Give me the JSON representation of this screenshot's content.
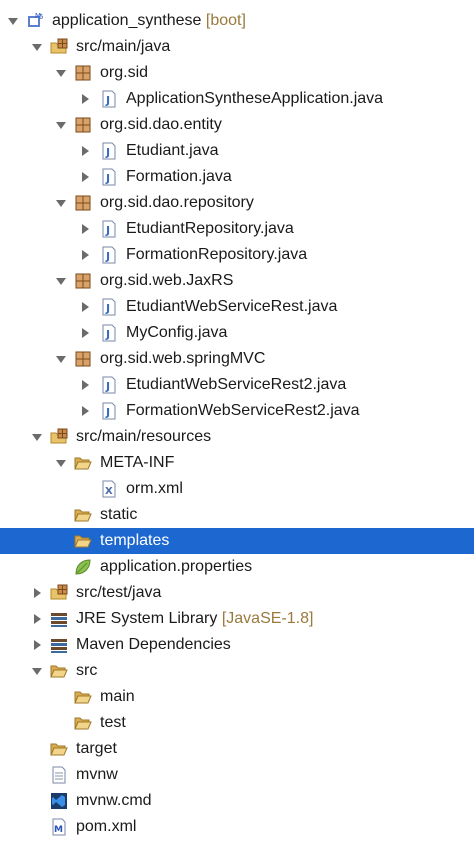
{
  "tree": {
    "project": {
      "label": "application_synthese",
      "decoration": "[boot]"
    },
    "src_main_java": {
      "label": "src/main/java"
    },
    "pkg_org_sid": {
      "label": "org.sid"
    },
    "file_app": {
      "label": "ApplicationSyntheseApplication.java"
    },
    "pkg_dao_entity": {
      "label": "org.sid.dao.entity"
    },
    "file_etudiant": {
      "label": "Etudiant.java"
    },
    "file_formation": {
      "label": "Formation.java"
    },
    "pkg_dao_repository": {
      "label": "org.sid.dao.repository"
    },
    "file_etu_repo": {
      "label": "EtudiantRepository.java"
    },
    "file_form_repo": {
      "label": "FormationRepository.java"
    },
    "pkg_web_jaxrs": {
      "label": "org.sid.web.JaxRS"
    },
    "file_etu_ws": {
      "label": "EtudiantWebServiceRest.java"
    },
    "file_myconfig": {
      "label": "MyConfig.java"
    },
    "pkg_web_springmvc": {
      "label": "org.sid.web.springMVC"
    },
    "file_etu_ws2": {
      "label": "EtudiantWebServiceRest2.java"
    },
    "file_form_ws2": {
      "label": "FormationWebServiceRest2.java"
    },
    "src_main_resources": {
      "label": "src/main/resources"
    },
    "folder_meta_inf": {
      "label": "META-INF"
    },
    "file_orm": {
      "label": "orm.xml"
    },
    "folder_static": {
      "label": "static"
    },
    "folder_templates": {
      "label": "templates"
    },
    "file_app_props": {
      "label": "application.properties"
    },
    "src_test_java": {
      "label": "src/test/java"
    },
    "jre_library": {
      "label": "JRE System Library",
      "decoration": "[JavaSE-1.8]"
    },
    "maven_deps": {
      "label": "Maven Dependencies"
    },
    "folder_src": {
      "label": "src"
    },
    "folder_main": {
      "label": "main"
    },
    "folder_test": {
      "label": "test"
    },
    "folder_target": {
      "label": "target"
    },
    "file_mvnw": {
      "label": "mvnw"
    },
    "file_mvnw_cmd": {
      "label": "mvnw.cmd"
    },
    "file_pom": {
      "label": "pom.xml"
    }
  },
  "selected_item": "templates",
  "colors": {
    "selection": "#1c68d0",
    "decoration": "#9a7a3c",
    "java_icon": "#3b6cc4",
    "folder": "#e8c36a"
  }
}
